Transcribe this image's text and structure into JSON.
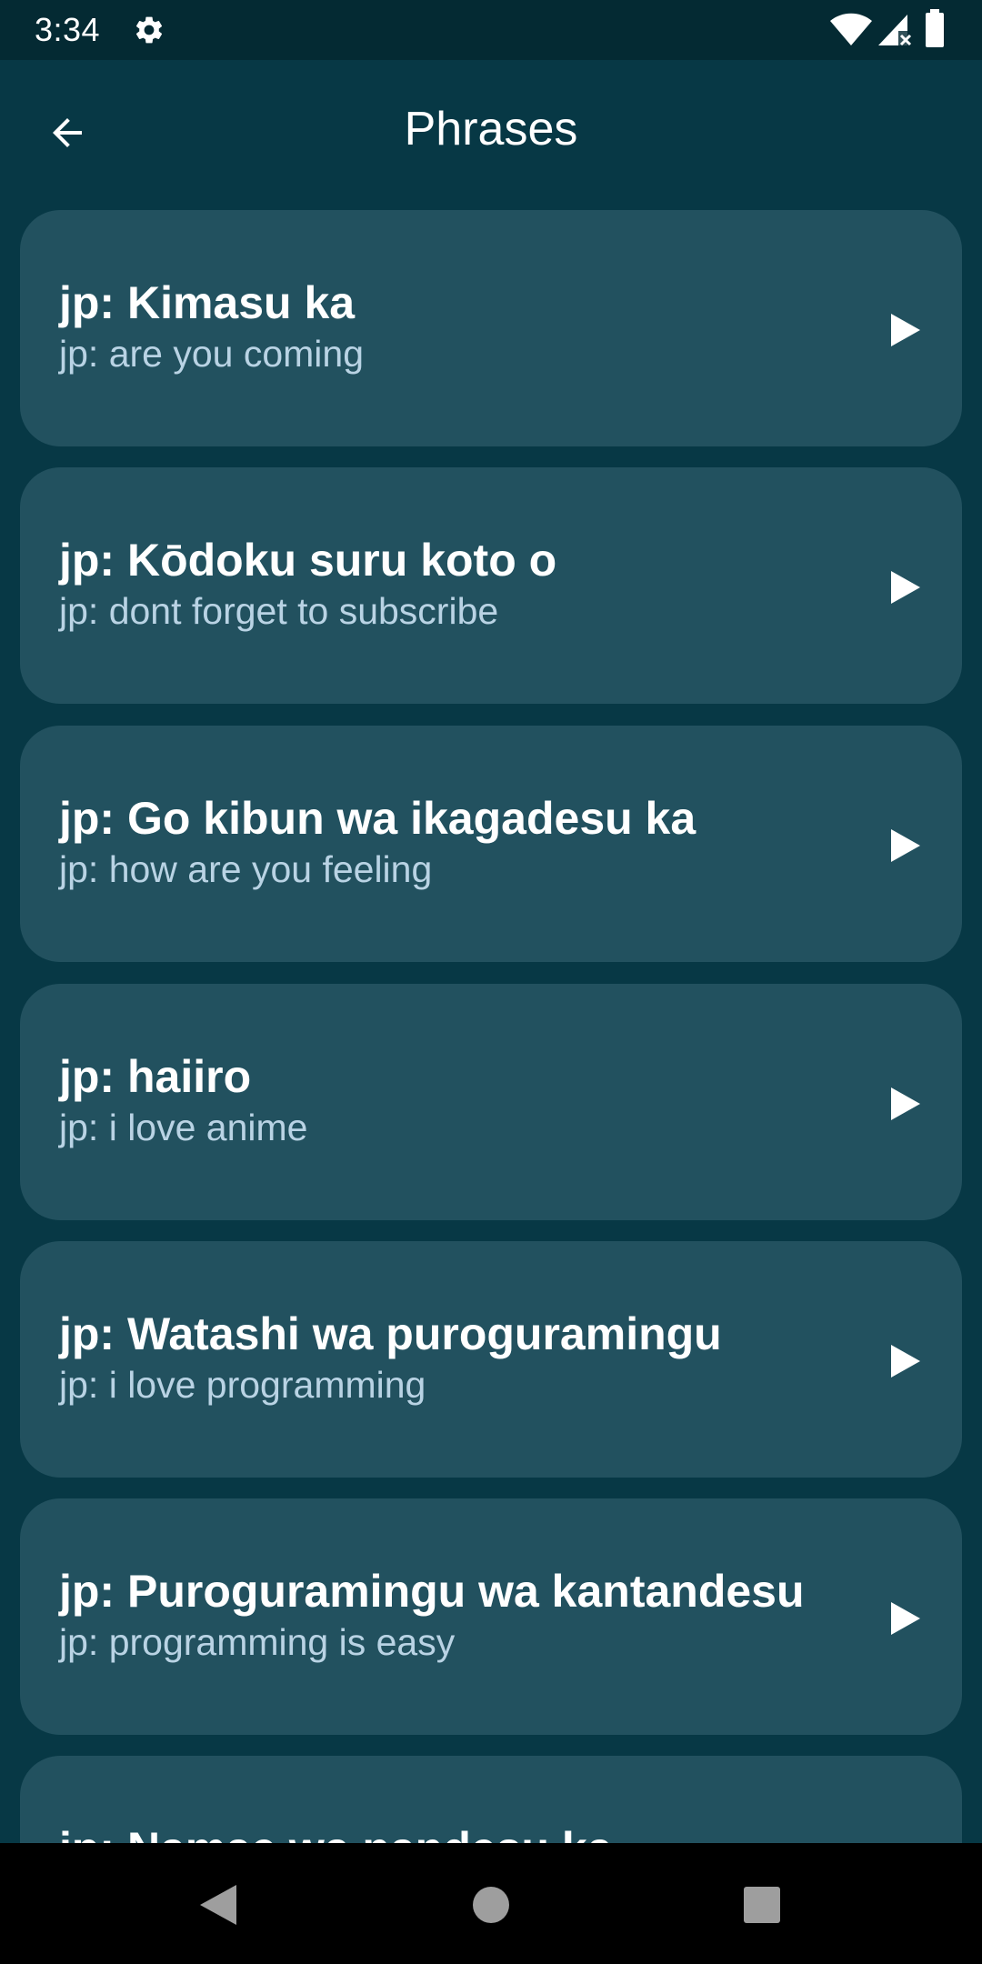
{
  "status_bar": {
    "time": "3:34",
    "icons": [
      "gear-icon",
      "wifi-icon",
      "signal-icon",
      "battery-icon"
    ]
  },
  "app_bar": {
    "title": "Phrases",
    "back_icon": "arrow-left-icon"
  },
  "phrases": [
    {
      "title": "jp: Kimasu ka",
      "subtitle": "jp: are you coming"
    },
    {
      "title": "jp: Kōdoku suru koto o",
      "subtitle": "jp: dont forget to subscribe"
    },
    {
      "title": "jp: Go kibun wa ikagadesu ka",
      "subtitle": "jp: how are you feeling"
    },
    {
      "title": "jp: haiiro",
      "subtitle": "jp: i love anime"
    },
    {
      "title": "jp: Watashi wa puroguramingu",
      "subtitle": "jp: i love programming"
    },
    {
      "title": "jp: Puroguramingu wa kantandesu",
      "subtitle": "jp: programming is easy"
    },
    {
      "title": "jp: Namae wa nandesu ka",
      "subtitle": ""
    }
  ],
  "nav_bar": {
    "buttons": [
      "back-triangle-icon",
      "home-circle-icon",
      "recents-square-icon"
    ]
  },
  "colors": {
    "background": "#073845",
    "status_bar": "#042a33",
    "card": "#22515f",
    "title_text": "#ffffff",
    "subtitle_text": "#b9d3e4",
    "nav_bar": "#000000"
  }
}
